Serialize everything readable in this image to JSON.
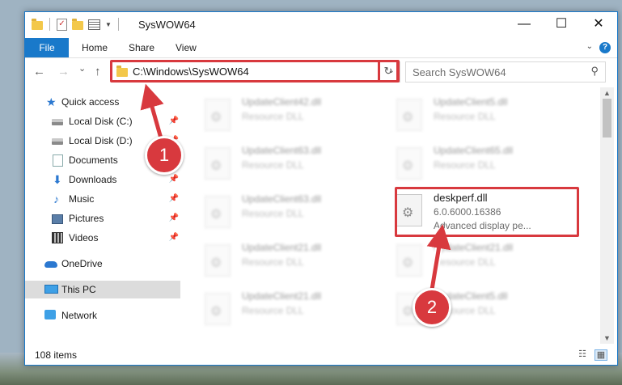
{
  "window": {
    "title": "SysWOW64",
    "controls": {
      "minimize": "—",
      "maximize": "☐",
      "close": "✕"
    }
  },
  "ribbon": {
    "file": "File",
    "tabs": [
      "Home",
      "Share",
      "View"
    ],
    "help": "?"
  },
  "nav": {
    "back": "←",
    "forward": "→",
    "recent": "⌄",
    "up": "↑",
    "address": "C:\\Windows\\SysWOW64",
    "address_dropdown": "⌄",
    "refresh": "↻",
    "search_placeholder": "Search SysWOW64",
    "search_icon": "⚲"
  },
  "sidebar": {
    "quick_access": "Quick access",
    "items": [
      {
        "label": "Local Disk (C:)",
        "icon": "drive-icon",
        "pinned": true
      },
      {
        "label": "Local Disk (D:)",
        "icon": "drive-icon",
        "pinned": true
      },
      {
        "label": "Documents",
        "icon": "documents-icon",
        "pinned": true
      },
      {
        "label": "Downloads",
        "icon": "downloads-icon",
        "pinned": true
      },
      {
        "label": "Music",
        "icon": "music-icon",
        "pinned": true
      },
      {
        "label": "Pictures",
        "icon": "pictures-icon",
        "pinned": true
      },
      {
        "label": "Videos",
        "icon": "videos-icon",
        "pinned": true
      }
    ],
    "onedrive": "OneDrive",
    "this_pc": "This PC",
    "network": "Network",
    "pin_glyph": "📌"
  },
  "files": {
    "left_column": [
      {
        "name": "UpdateClient42.dll",
        "type": "Resource DLL"
      },
      {
        "name": "UpdateClient63.dll",
        "type": "Resource DLL"
      },
      {
        "name": "UpdateClient63.dll",
        "type": "Resource DLL"
      },
      {
        "name": "UpdateClient21.dll",
        "type": "Resource DLL"
      },
      {
        "name": "UpdateClient21.dll",
        "type": "Resource DLL"
      }
    ],
    "right_column": [
      {
        "name": "UpdateClient5.dll",
        "type": "Resource DLL"
      },
      {
        "name": "UpdateClient65.dll",
        "type": "Resource DLL"
      },
      {
        "name": "UpdateClient21.dll",
        "type": "Resource DLL"
      },
      {
        "name": "UpdateClient5.dll",
        "type": "Resource DLL"
      }
    ],
    "highlighted": {
      "name": "deskperf.dll",
      "version": "6.0.6000.16386",
      "description": "Advanced display pe..."
    }
  },
  "status": {
    "item_count": "108 items"
  },
  "annotations": {
    "step1": "1",
    "step2": "2"
  },
  "colors": {
    "accent": "#1979ca",
    "highlight_red": "#d8393e",
    "selected_bg": "#dcdcdc"
  }
}
